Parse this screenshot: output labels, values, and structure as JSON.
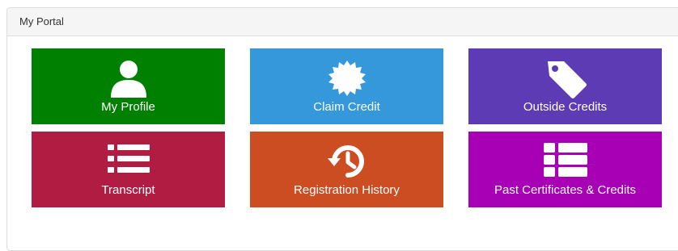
{
  "panel": {
    "title": "My Portal"
  },
  "tiles": [
    {
      "label": "My Profile",
      "icon": "user-icon",
      "color": "#008000"
    },
    {
      "label": "Claim Credit",
      "icon": "certificate-icon",
      "color": "#3498db"
    },
    {
      "label": "Outside Credits",
      "icon": "tag-icon",
      "color": "#5d3bb5"
    },
    {
      "label": "Transcript",
      "icon": "list-icon",
      "color": "#b01c42"
    },
    {
      "label": "Registration History",
      "icon": "history-icon",
      "color": "#cc4d22"
    },
    {
      "label": "Past Certificates & Credits",
      "icon": "table-list-icon",
      "color": "#a800b4"
    }
  ]
}
